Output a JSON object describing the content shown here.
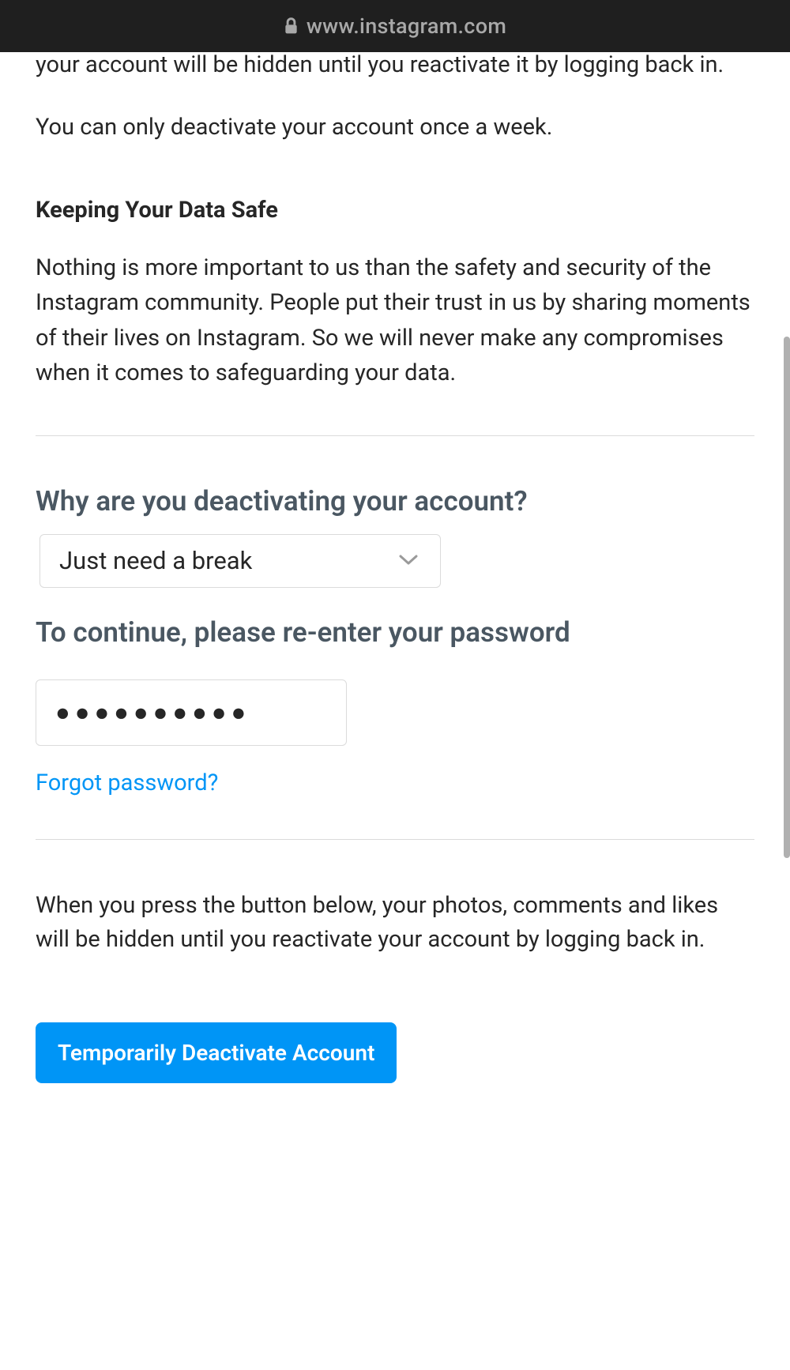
{
  "addressbar": {
    "url_text": "www.instagram.com"
  },
  "content": {
    "intro_p1": "You can deactivate your account instead of deleting it. This means your account will be hidden until you reactivate it by logging back in.",
    "intro_p2": "You can only deactivate your account once a week.",
    "data_safe_heading": "Keeping Your Data Safe",
    "data_safe_body": "Nothing is more important to us than the safety and security of the Instagram community. People put their trust in us by sharing moments of their lives on Instagram. So we will never make any compromises when it comes to safeguarding your data.",
    "reason_question": "Why are you deactivating your account?",
    "reason_selected": "Just need a break",
    "password_prompt": "To continue, please re-enter your password",
    "password_value": "●●●●●●●●●●",
    "forgot_password": "Forgot password?",
    "confirm_body": "When you press the button below, your photos, comments and likes will be hidden until you reactivate your account by logging back in.",
    "deactivate_button": "Temporarily Deactivate Account"
  }
}
